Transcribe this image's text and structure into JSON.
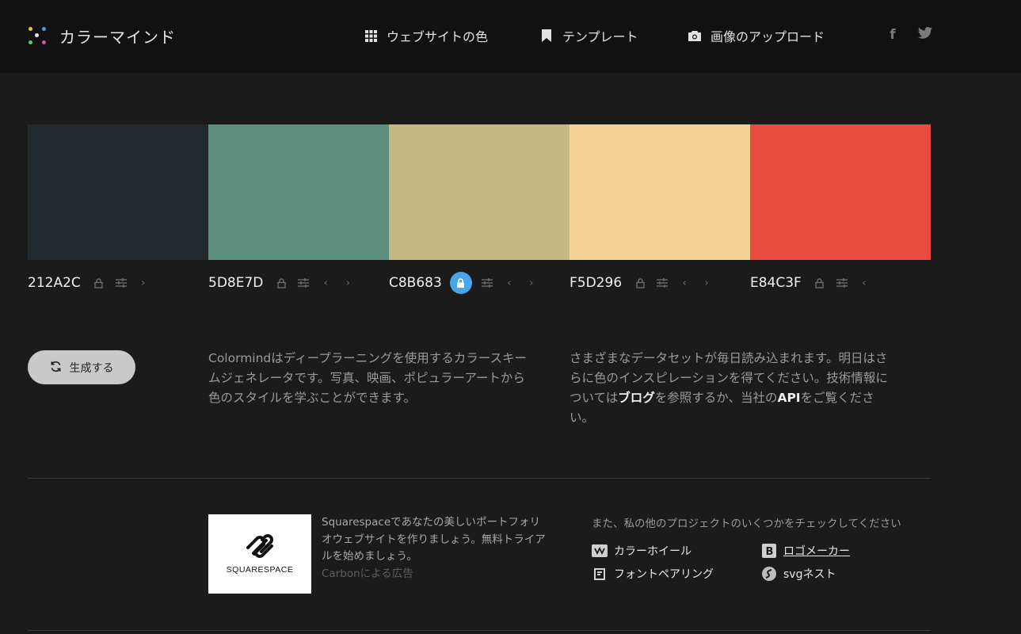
{
  "header": {
    "title": "カラーマインド",
    "nav": [
      {
        "label": "ウェブサイトの色",
        "icon": "grid-icon"
      },
      {
        "label": "テンプレート",
        "icon": "bookmark-icon"
      },
      {
        "label": "画像のアップロード",
        "icon": "camera-icon"
      }
    ],
    "social": [
      {
        "icon": "facebook-icon",
        "glyph": "f"
      },
      {
        "icon": "twitter-icon",
        "glyph": "t"
      }
    ]
  },
  "palette": [
    {
      "hex": "212A2C",
      "color": "#212A2C",
      "locked": false
    },
    {
      "hex": "5D8E7D",
      "color": "#5D8E7D",
      "locked": false
    },
    {
      "hex": "C8B683",
      "color": "#C8B683",
      "locked": true
    },
    {
      "hex": "F5D296",
      "color": "#F5D296",
      "locked": false
    },
    {
      "hex": "E84C3F",
      "color": "#E84C3F",
      "locked": false
    }
  ],
  "generate": {
    "label": "生成する"
  },
  "description": {
    "left": "Colormindはディープラーニングを使用するカラースキームジェネレータです。写真、映画、ポピュラーアートから色のスタイルを学ぶことができます。",
    "right_part1": "さまざまなデータセットが毎日読み込まれます。明日はさらに色のインスピレーションを得てください。技術情報については",
    "right_link1": "ブログ",
    "right_part2": "を参照するか、当社の",
    "right_link2": "API",
    "right_part3": "をご覧ください。"
  },
  "ad": {
    "brand": "SQUARESPACE",
    "text": "Squarespaceであなたの美しいポートフォリオウェブサイトを作りましょう。無料トライアルを始めましょう。",
    "credit": "Carbonによる広告"
  },
  "projects": {
    "title": "また、私の他のプロジェクトのいくつかをチェックしてください",
    "items": [
      {
        "label": "カラーホイール",
        "icon": "color-wheel-icon"
      },
      {
        "label": "ロゴメーカー",
        "icon": "logo-maker-icon"
      },
      {
        "label": "フォントペアリング",
        "icon": "font-pairing-icon"
      },
      {
        "label": "svgネスト",
        "icon": "svgnest-icon"
      }
    ]
  },
  "colors": {
    "accent": "#48A6E8",
    "header_bg": "#111111",
    "page_bg": "#1B1B1B"
  }
}
